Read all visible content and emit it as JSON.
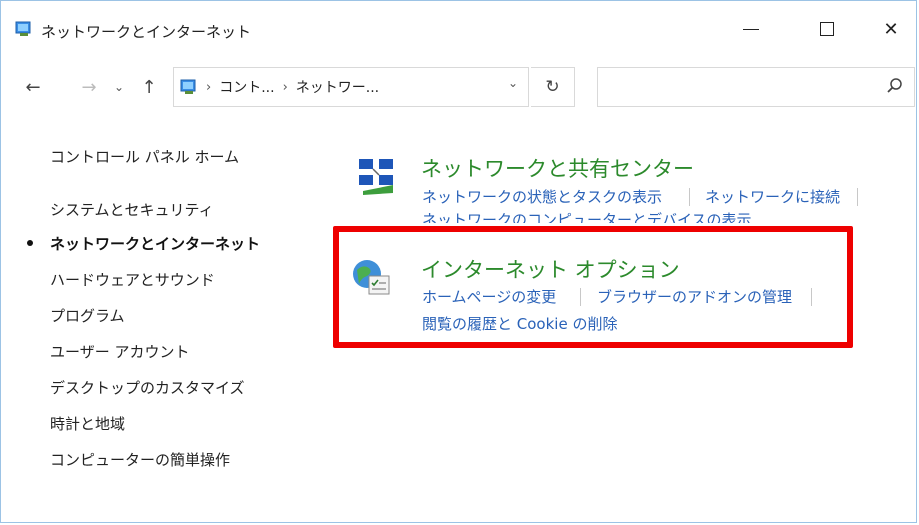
{
  "window": {
    "title": "ネットワークとインターネット",
    "controls": {
      "minimize": "—",
      "maximize": "☐",
      "close": "✕"
    }
  },
  "toolbar": {
    "back": "←",
    "forward": "→",
    "recent": "⌄",
    "up": "↑",
    "breadcrumbs": [
      "コント...",
      "ネットワー..."
    ],
    "breadcrumb_separator": "›",
    "refresh": "↻",
    "search_placeholder": ""
  },
  "sidebar": {
    "items": [
      {
        "label": "コントロール パネル ホーム",
        "current": false
      },
      {
        "label": "システムとセキュリティ",
        "current": false
      },
      {
        "label": "ネットワークとインターネット",
        "current": true
      },
      {
        "label": "ハードウェアとサウンド",
        "current": false
      },
      {
        "label": "プログラム",
        "current": false
      },
      {
        "label": "ユーザー アカウント",
        "current": false
      },
      {
        "label": "デスクトップのカスタマイズ",
        "current": false
      },
      {
        "label": "時計と地域",
        "current": false
      },
      {
        "label": "コンピューターの簡単操作",
        "current": false
      }
    ]
  },
  "categories": {
    "network_center": {
      "title": "ネットワークと共有センター",
      "links": [
        "ネットワークの状態とタスクの表示",
        "ネットワークに接続",
        "ネットワークのコンピューターとデバイスの表示"
      ]
    },
    "internet_options": {
      "title": "インターネット オプション",
      "links": [
        "ホームページの変更",
        "ブラウザーのアドオンの管理",
        "閲覧の履歴と Cookie の削除"
      ]
    }
  },
  "colors": {
    "category_title": "#2c8a2c",
    "link": "#2a62b8",
    "highlight": "#ee0000"
  }
}
